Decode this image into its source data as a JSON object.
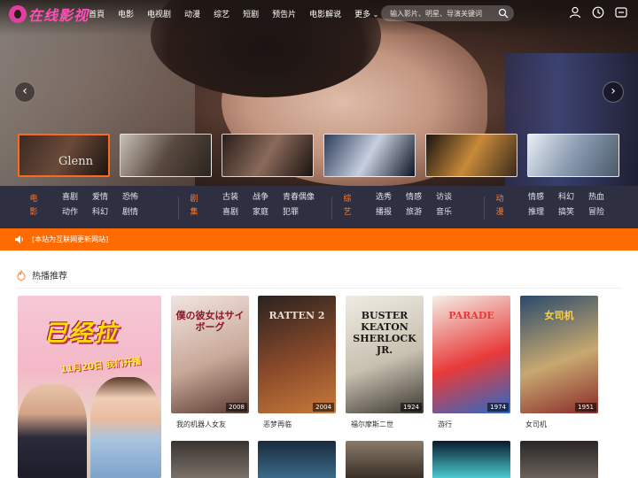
{
  "header": {
    "logo_text": "在线影视",
    "nav": [
      "首頁",
      "电影",
      "电视剧",
      "动漫",
      "综艺",
      "短剧",
      "预告片",
      "电影解说",
      "更多"
    ],
    "search_placeholder": "输入影片、明星、导演关键词",
    "icons": [
      "user-icon",
      "history-icon",
      "app-icon"
    ]
  },
  "hero": {
    "prev_icon": "‹",
    "next_icon": "›",
    "thumbnails": [
      {
        "caption": "Glenn",
        "colors": [
          "#3a2a22",
          "#6a4a3a",
          "#1c140f"
        ]
      },
      {
        "caption": "",
        "colors": [
          "#c8c0b8",
          "#5a4a40",
          "#2a2420"
        ]
      },
      {
        "caption": "",
        "colors": [
          "#2a1e1a",
          "#8a6a5a",
          "#1a1210"
        ]
      },
      {
        "caption": "",
        "colors": [
          "#2c3c5a",
          "#c8d0e0",
          "#0c1424"
        ]
      },
      {
        "caption": "",
        "colors": [
          "#1a1410",
          "#c88a3a",
          "#3a2a1c"
        ]
      },
      {
        "caption": "",
        "colors": [
          "#e8eef4",
          "#8a9ab0",
          "#4a5a6a"
        ]
      }
    ]
  },
  "categories": [
    {
      "label": "电影",
      "items": [
        "喜剧",
        "爱情",
        "恐怖",
        "动作",
        "科幻",
        "剧情"
      ]
    },
    {
      "label": "剧集",
      "items": [
        "古装",
        "战争",
        "青春偶像",
        "喜剧",
        "家庭",
        "犯罪"
      ]
    },
    {
      "label": "综艺",
      "items": [
        "选秀",
        "情感",
        "访谈",
        "播报",
        "旅游",
        "音乐"
      ]
    },
    {
      "label": "动漫",
      "items": [
        "情感",
        "科幻",
        "热血",
        "推理",
        "搞笑",
        "冒险"
      ]
    }
  ],
  "notice": {
    "text": "[本站为互联网更新网站]"
  },
  "hot": {
    "title": "热播推荐",
    "featured": {
      "title": "已经拉",
      "subtitle": "11月20日 我们开播"
    },
    "movies": [
      {
        "name": "我的机器人女友",
        "year": "2008",
        "poster_text": "僕の彼女はサイボーグ",
        "colors": [
          "#f2e4e0",
          "#c8a898",
          "#5a3a30"
        ]
      },
      {
        "name": "恶梦再临",
        "year": "2004",
        "poster_text": "RATTEN 2",
        "colors": [
          "#2a2220",
          "#8a4a2a",
          "#c87a3a"
        ]
      },
      {
        "name": "福尔摩斯二世",
        "year": "1924",
        "poster_text": "BUSTER KEATON SHERLOCK JR.",
        "colors": [
          "#f0ece4",
          "#c8c0b0",
          "#3a3630"
        ]
      },
      {
        "name": "游行",
        "year": "1974",
        "poster_text": "PARADE",
        "colors": [
          "#f4f0e8",
          "#e83a3a",
          "#2a6ac8"
        ]
      },
      {
        "name": "女司机",
        "year": "1951",
        "poster_text": "女司机",
        "colors": [
          "#2a4a6a",
          "#c8a870",
          "#8a2a2a"
        ]
      }
    ],
    "row2_colors": [
      [
        "#3a3430",
        "#7a7068"
      ],
      [
        "#1a2a3a",
        "#3a6a8a"
      ],
      [
        "#8a7a6a",
        "#3a3028"
      ],
      [
        "#0a1a2a",
        "#4acad0"
      ],
      [
        "#2a2624",
        "#6a625a"
      ]
    ]
  }
}
